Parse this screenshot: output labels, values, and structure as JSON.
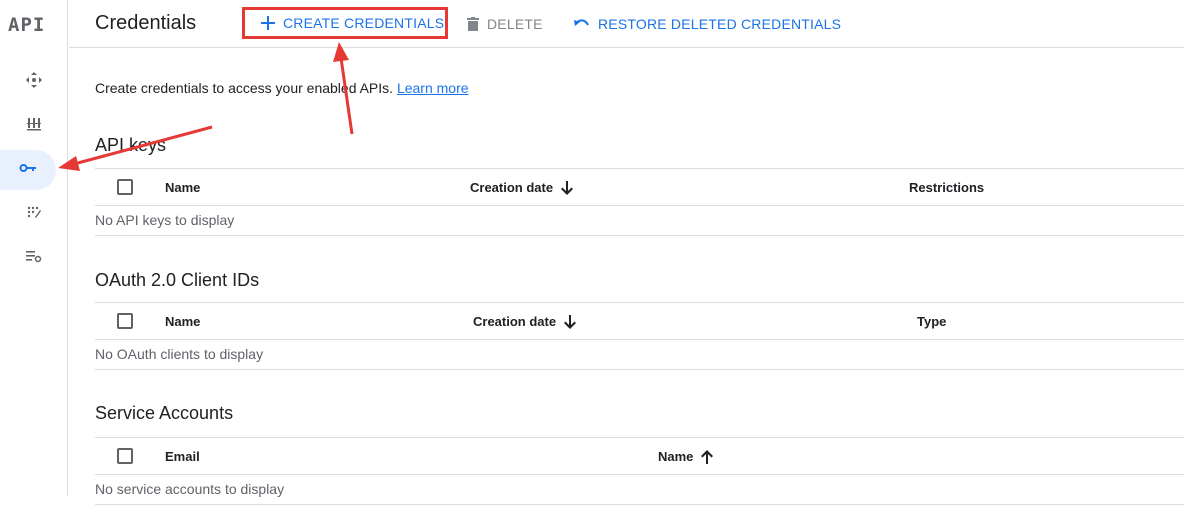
{
  "app": {
    "logo_text": "API"
  },
  "rail": {
    "items": [
      {
        "icon": "diamond-arrows-icon"
      },
      {
        "icon": "library-icon"
      },
      {
        "icon": "key-icon",
        "active": true
      },
      {
        "icon": "consent-screen-icon"
      },
      {
        "icon": "settings-list-icon"
      }
    ]
  },
  "header": {
    "title": "Credentials",
    "create_label": "CREATE CREDENTIALS",
    "delete_label": "DELETE",
    "restore_label": "RESTORE DELETED CREDENTIALS"
  },
  "intro": {
    "text": "Create credentials to access your enabled APIs.",
    "link": "Learn more"
  },
  "api_keys": {
    "title": "API keys",
    "columns": [
      "Name",
      "Creation date",
      "Restrictions"
    ],
    "empty": "No API keys to display"
  },
  "oauth": {
    "title": "OAuth 2.0 Client IDs",
    "columns": [
      "Name",
      "Creation date",
      "Type"
    ],
    "empty": "No OAuth clients to display"
  },
  "service_accounts": {
    "title": "Service Accounts",
    "columns": [
      "Email",
      "Name"
    ],
    "empty": "No service accounts to display"
  },
  "colors": {
    "accent": "#1a73e8",
    "annotation": "#e53935",
    "muted": "#5f6368",
    "divider": "#dadce0"
  }
}
